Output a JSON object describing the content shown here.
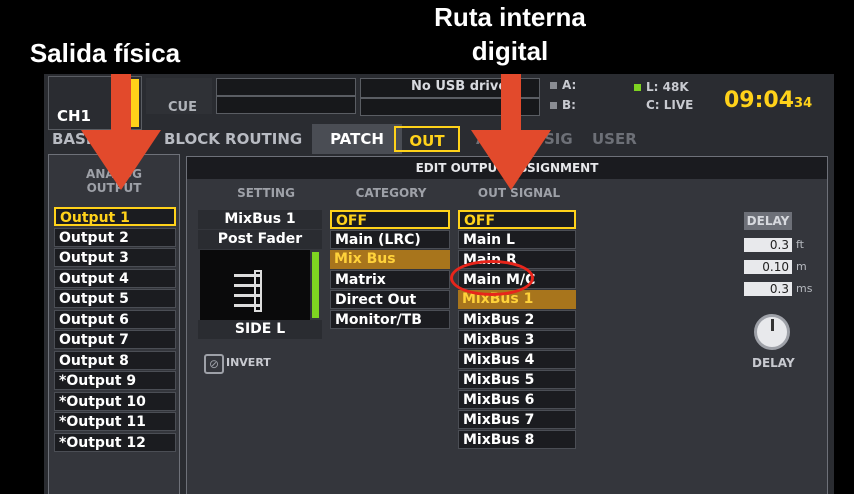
{
  "annotations": {
    "left_caption": "Salida física",
    "right_caption_line1": "Ruta interna",
    "right_caption_line2": "digital"
  },
  "header": {
    "channel": "CH1",
    "cue": "CUE",
    "usb": "No USB drive",
    "a_label": "A:",
    "b_label": "B:",
    "l_label": "L: 48K",
    "c_label": "C: LIVE",
    "clock": "09:04",
    "clock_seconds": "34"
  },
  "tabs": [
    "BASIC",
    "BLOCK ROUTING",
    "PATCH",
    "OUT",
    "AUX",
    "SIG",
    "USER"
  ],
  "title": "EDIT OUTPUT ASSIGNMENT",
  "analog_output": {
    "header": "ANALOG OUTPUT",
    "items": [
      "Output 1",
      "Output 2",
      "Output 3",
      "Output 4",
      "Output 5",
      "Output 6",
      "Output 7",
      "Output 8",
      "*Output 9",
      "*Output 10",
      "*Output 11",
      "*Output 12"
    ]
  },
  "setting": {
    "header": "SETTING",
    "line1": "MixBus 1",
    "line2": "Post Fader",
    "side": "SIDE L",
    "invert": "INVERT"
  },
  "category": {
    "header": "CATEGORY",
    "items": [
      "OFF",
      "Main (LRC)",
      "Mix Bus",
      "Matrix",
      "Direct Out",
      "Monitor/TB"
    ]
  },
  "out_signal": {
    "header": "OUT SIGNAL",
    "items": [
      "OFF",
      "Main L",
      "Main R",
      "Main M/C",
      "MixBus 1",
      "MixBus 2",
      "MixBus 3",
      "MixBus 4",
      "MixBus 5",
      "MixBus 6",
      "MixBus 7",
      "MixBus 8"
    ]
  },
  "delay": {
    "label": "DELAY",
    "ft_value": "0.3",
    "ft_unit": "ft",
    "m_value": "0.10",
    "m_unit": "m",
    "ms_value": "0.3",
    "ms_unit": "ms",
    "knob_label": "DELAY"
  },
  "colors": {
    "accent_yellow": "#ffd21a",
    "arrow_red": "#e24a2c",
    "meter_green": "#7ed321"
  }
}
